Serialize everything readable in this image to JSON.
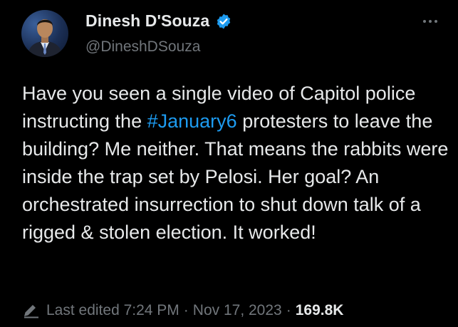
{
  "author": {
    "display_name": "Dinesh D'Souza",
    "handle": "@DineshDSouza",
    "verified": true
  },
  "tweet": {
    "text_parts": [
      "Have you seen a single video of Capitol police instructing the ",
      "#January6",
      " protesters to leave the building? Me neither. That means the rabbits were inside the trap set by Pelosi. Her goal? An orchestrated insurrection to shut down talk of a rigged & stolen election. It worked!"
    ]
  },
  "meta": {
    "edited_label": "Last edited 7:24 PM",
    "date": "Nov 17, 2023",
    "separator": "·",
    "views": "169.8K"
  },
  "colors": {
    "background": "#000000",
    "text": "#e7e9ea",
    "muted": "#71767b",
    "accent": "#1d9bf0"
  },
  "icons": {
    "verified": "verified-badge-icon",
    "more": "more-options-icon",
    "edited": "pencil-icon"
  }
}
